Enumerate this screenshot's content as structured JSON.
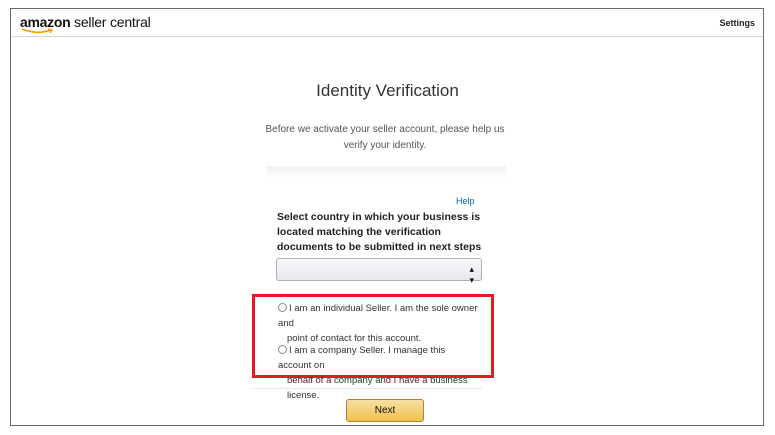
{
  "header": {
    "logo_brand": "amazon",
    "logo_rest": " seller central",
    "settings_label": "Settings"
  },
  "main": {
    "title": "Identity Verification",
    "intro": "Before we activate your seller account, please help us verify your identity.",
    "help_label": "Help",
    "country_label": "Select country in which your business is located matching the verification documents to be submitted in next steps",
    "country_select_value": "",
    "seller_type_options": [
      {
        "line1": "I am an individual Seller. I am the sole owner and",
        "line2": "point of contact for this account."
      },
      {
        "line1": "I am a company Seller. I manage this account on",
        "line2": "behalf of a company and I have a business license."
      }
    ],
    "next_label": "Next"
  },
  "colors": {
    "highlight_border": "#e51b24",
    "help_link": "#0066c0",
    "button_top": "#f7dfa5",
    "button_bottom": "#f0c14b",
    "logo_smile": "#ff9900"
  },
  "icons": {
    "select_arrow": "up-down-caret-icon",
    "logo_smile": "amazon-smile-icon"
  }
}
